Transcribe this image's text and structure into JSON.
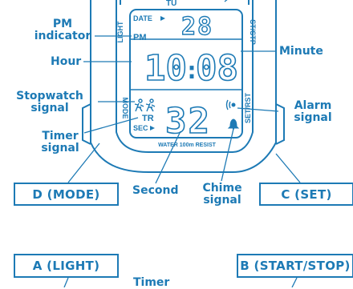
{
  "colors": {
    "primary": "#1d7ab5",
    "background": "#ffffff"
  },
  "display": {
    "day": "TU",
    "date_label": "DATE",
    "date_value": "28",
    "pm": "PM",
    "hour": "10",
    "minute": "08",
    "timer_mode": "TR",
    "sec_label": "SEC",
    "second": "32",
    "water_resist": "WATER 100m RESIST"
  },
  "bezel": {
    "light": "LIGHT",
    "st_stp": "ST/STP",
    "mode": "MODE",
    "set_rst": "SET/RST"
  },
  "callouts": {
    "pm_indicator": [
      "PM",
      "indicator"
    ],
    "hour": "Hour",
    "minute": "Minute",
    "stopwatch_signal": [
      "Stopwatch",
      "signal"
    ],
    "alarm_signal": [
      "Alarm",
      "signal"
    ],
    "timer_signal": [
      "Timer",
      "signal"
    ],
    "second": "Second",
    "chime_signal": [
      "Chime",
      "signal"
    ],
    "timer_bottom": "Timer"
  },
  "buttons": {
    "d_mode": "D (MODE)",
    "c_set": "C (SET)",
    "a_light": "A (LIGHT)",
    "b_start_stop": "B (START/STOP)"
  },
  "icons": [
    "stopwatch-runner-icon",
    "alarm-icon",
    "chime-bell-icon",
    "date-arrow-icon",
    "sec-arrow-icon"
  ]
}
